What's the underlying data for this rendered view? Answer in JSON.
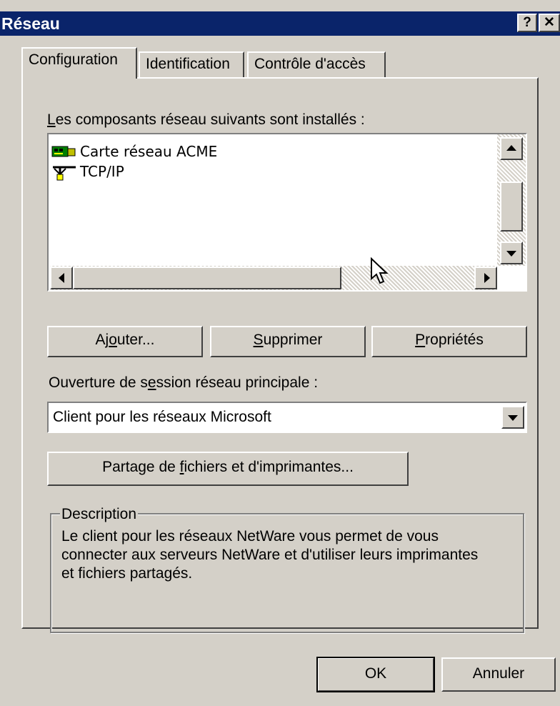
{
  "window": {
    "title": "Réseau",
    "help_glyph": "?",
    "close_glyph": "✕"
  },
  "tabs": [
    {
      "label": "Configuration",
      "active": true
    },
    {
      "label": "Identification",
      "active": false
    },
    {
      "label": "Contrôle d'accès",
      "active": false
    }
  ],
  "components": {
    "label_prefix": "L",
    "label_rest": "es composants réseau suivants sont installés :",
    "items": [
      {
        "label": "Carte réseau ACME",
        "icon": "network-card-icon"
      },
      {
        "label": "TCP/IP",
        "icon": "protocol-icon"
      }
    ]
  },
  "buttons": {
    "add_a": "Aj",
    "add_u": "o",
    "add_b": "uter...",
    "remove_u": "S",
    "remove_b": "upprimer",
    "props_u": "P",
    "props_b": "ropriétés"
  },
  "logon": {
    "label_a": "Ouverture de s",
    "label_u": "e",
    "label_b": "ssion réseau principale :",
    "value": "Client pour les réseaux Microsoft"
  },
  "share": {
    "label_a": "Partage de ",
    "label_u": "f",
    "label_b": "ichiers et d'imprimantes..."
  },
  "description": {
    "legend": "Description",
    "lines": [
      "Le client pour les réseaux NetWare vous permet de vous",
      "connecter aux serveurs NetWare et d'utiliser leurs imprimantes",
      "et fichiers partagés."
    ]
  },
  "footer": {
    "ok": "OK",
    "cancel": "Annuler"
  }
}
